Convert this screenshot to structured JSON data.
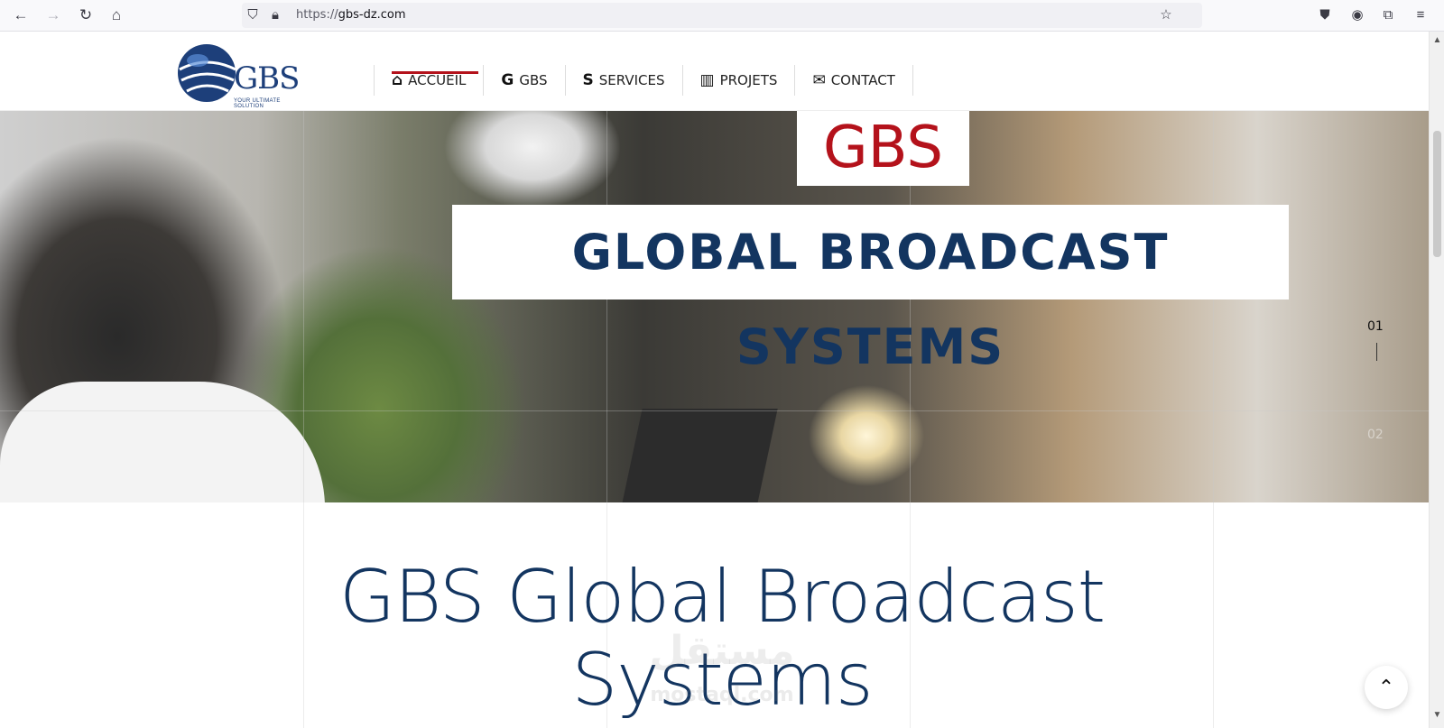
{
  "browser": {
    "url_scheme": "https://",
    "url_host": "gbs-dz.com",
    "icons": [
      "back-arrow-icon",
      "forward-arrow-icon",
      "reload-icon",
      "home-icon",
      "shield-icon",
      "lock-icon",
      "star-icon",
      "pocket-icon",
      "account-icon",
      "extensions-icon",
      "menu-icon"
    ]
  },
  "header": {
    "logo_text": "GBS",
    "logo_tagline": "YOUR ULTIMATE SOLUTION",
    "menu": [
      {
        "label": "ACCUEIL",
        "icon": "home-icon",
        "glyph": "⌂",
        "active": true
      },
      {
        "label": "GBS",
        "icon": "g-letter-icon",
        "glyph": "G",
        "active": false
      },
      {
        "label": "SERVICES",
        "icon": "s-letter-icon",
        "glyph": "S",
        "active": false
      },
      {
        "label": "PROJETS",
        "icon": "book-icon",
        "glyph": "▥",
        "active": false
      },
      {
        "label": "CONTACT",
        "icon": "envelope-icon",
        "glyph": "✉",
        "active": false
      }
    ],
    "accent_color": "#b4121b"
  },
  "hero": {
    "brand": "GBS",
    "title": "GLOBAL BROADCAST SYSTEMS",
    "slide_current": "01",
    "slide_next": "02",
    "title_color": "#133560"
  },
  "main": {
    "title": "GBS Global Broadcast Systems",
    "watermark_ar": "مستقل",
    "watermark_url": "mostaql.com"
  }
}
